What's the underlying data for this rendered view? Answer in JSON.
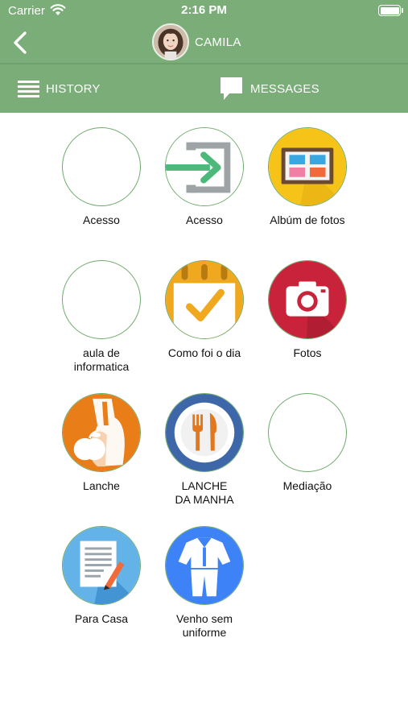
{
  "status": {
    "carrier": "Carrier",
    "time": "2:16 PM"
  },
  "header": {
    "name": "CAMILA"
  },
  "tabs": {
    "history": "HISTORY",
    "messages": "MESSAGES"
  },
  "grid": [
    {
      "label": "Acesso"
    },
    {
      "label": "Acesso"
    },
    {
      "label": "Albúm de fotos"
    },
    {
      "label": "aula de\ninformatica"
    },
    {
      "label": "Como foi o dia"
    },
    {
      "label": "Fotos"
    },
    {
      "label": "Lanche"
    },
    {
      "label": "LANCHE\nDA MANHA"
    },
    {
      "label": "Mediação"
    },
    {
      "label": "Para Casa"
    },
    {
      "label": "Venho sem\nuniforme"
    }
  ],
  "colors": {
    "header_green": "#7aad78",
    "tile_border": "#6eab6c",
    "yellow": "#f6c419",
    "orange": "#f0a81e",
    "red": "#c8233a",
    "blue": "#3e82f7",
    "light_blue": "#63b3e8",
    "plate_ring": "#3d67a8",
    "cutlery": "#e07820"
  },
  "icons": [
    "back-chevron-icon",
    "wifi-icon",
    "battery-icon",
    "history-list-icon",
    "message-bubble-icon",
    "login-arrow-icon",
    "photo-album-icon",
    "calendar-check-icon",
    "camera-icon",
    "apple-apron-icon",
    "plate-cutlery-icon",
    "homework-paper-icon",
    "uniform-icon"
  ]
}
